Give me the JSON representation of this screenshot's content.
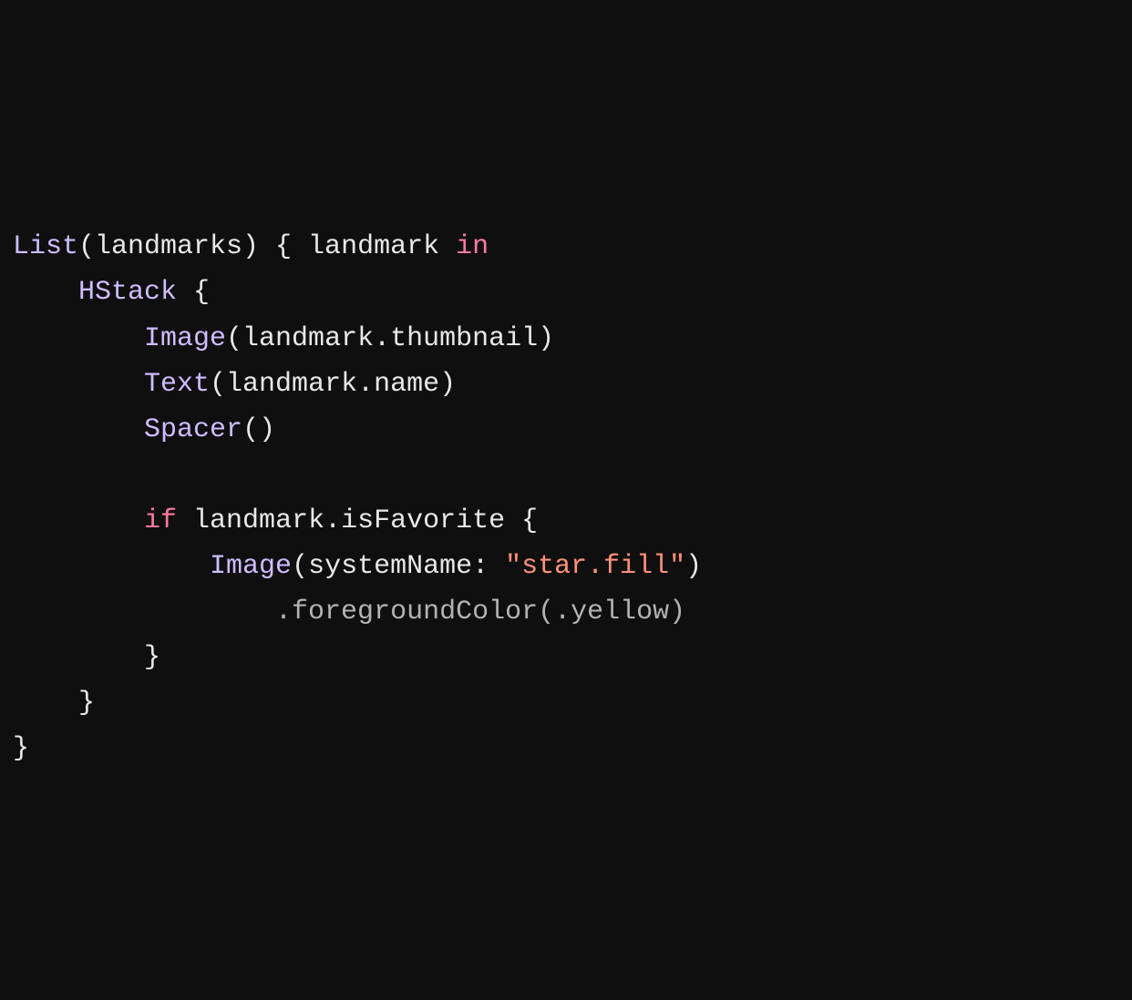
{
  "code": {
    "line1": {
      "t1": "List",
      "t2": "(landmarks) { landmark ",
      "t3": "in"
    },
    "line2": {
      "indent": "    ",
      "t1": "HStack",
      "t2": " {"
    },
    "line3": {
      "indent": "        ",
      "t1": "Image",
      "t2": "(landmark.thumbnail)"
    },
    "line4": {
      "indent": "        ",
      "t1": "Text",
      "t2": "(landmark.name)"
    },
    "line5": {
      "indent": "        ",
      "t1": "Spacer",
      "t2": "()"
    },
    "line6": {
      "t1": ""
    },
    "line7": {
      "indent": "        ",
      "t1": "if",
      "t2": " landmark.isFavorite {"
    },
    "line8": {
      "indent": "            ",
      "t1": "Image",
      "t2": "(systemName: ",
      "t3": "\"star.fill\"",
      "t4": ")"
    },
    "line9": {
      "indent": "                ",
      "t1": ".foregroundColor(.yellow)"
    },
    "line10": {
      "indent": "        ",
      "t1": "}"
    },
    "line11": {
      "indent": "    ",
      "t1": "}"
    },
    "line12": {
      "t1": "}"
    }
  }
}
